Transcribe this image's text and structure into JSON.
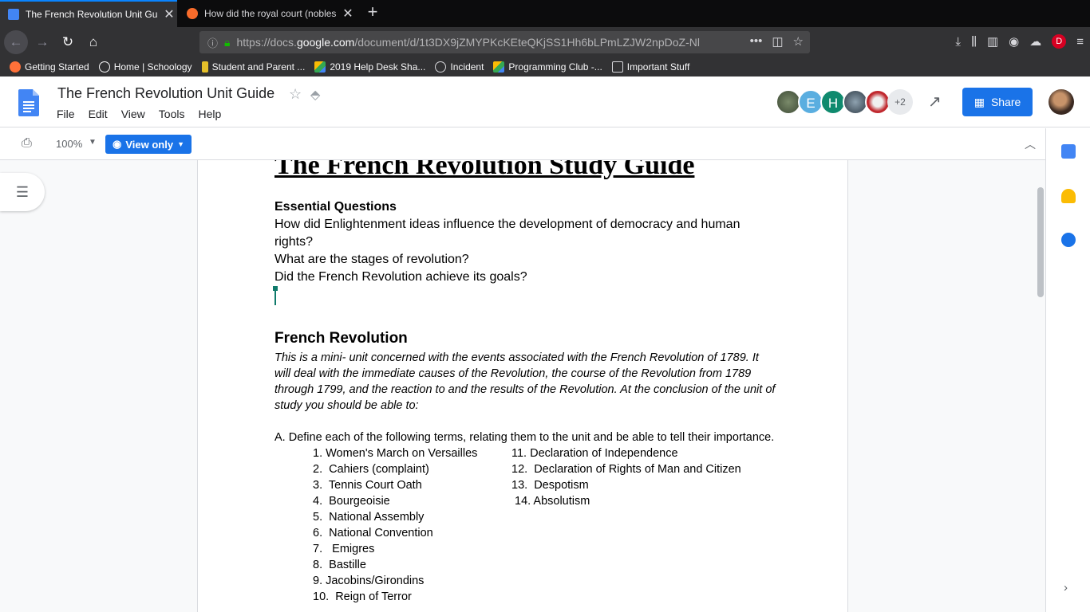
{
  "browser": {
    "tabs": [
      {
        "title": "The French Revolution Unit Guide",
        "active": true
      },
      {
        "title": "How did the royal court (nobles",
        "active": false
      }
    ],
    "url": {
      "prefix": "https://docs.",
      "domain": "google.com",
      "path": "/document/d/1t3DX9jZMYPKcKEteQKjSS1Hh6bLPmLZJW2npDoZ-Nl"
    },
    "bookmarks": [
      "Getting Started",
      "Home | Schoology",
      "Student and Parent ...",
      "2019 Help Desk Sha...",
      "Incident",
      "Programming Club -...",
      "Important Stuff"
    ],
    "profile_letter": "D"
  },
  "docs": {
    "title": "The French Revolution Unit Guide",
    "menu": [
      "File",
      "Edit",
      "View",
      "Tools",
      "Help"
    ],
    "collaborators": [
      "E",
      "H"
    ],
    "more_collaborators": "+2",
    "share_label": "Share",
    "zoom": "100%",
    "mode_label": "View only"
  },
  "document": {
    "heading": "The French Revolution Study Guide",
    "essential_title": "Essential Questions",
    "questions": [
      "How did Enlightenment ideas influence the development of democracy and human rights?",
      "What are the stages of revolution?",
      "Did the French Revolution achieve its goals?"
    ],
    "section_title": "French Revolution",
    "intro": "This is a mini- unit concerned with the events associated with the French Revolution of 1789.  It will deal with the immediate causes of the Revolution, the course of the Revolution from 1789 through 1799, and the reaction to and the results of the Revolution. At the conclusion of the unit of study you should be able to:",
    "instruction": "A.  Define each of the following terms, relating them to the unit and be able to tell their importance.",
    "terms_left": [
      "1. Women's March on Versailles",
      "2.  Cahiers (complaint)",
      "3.  Tennis Court Oath",
      "4.  Bourgeoisie",
      "5.  National Assembly",
      "6.  National Convention",
      "7.   Emigres",
      "8.  Bastille",
      "9. Jacobins/Girondins",
      "10.  Reign of Terror"
    ],
    "terms_right": [
      "11. Declaration of Independence",
      "12.  Declaration of Rights of Man and Citizen",
      "13.  Despotism",
      " 14. Absolutism"
    ]
  }
}
